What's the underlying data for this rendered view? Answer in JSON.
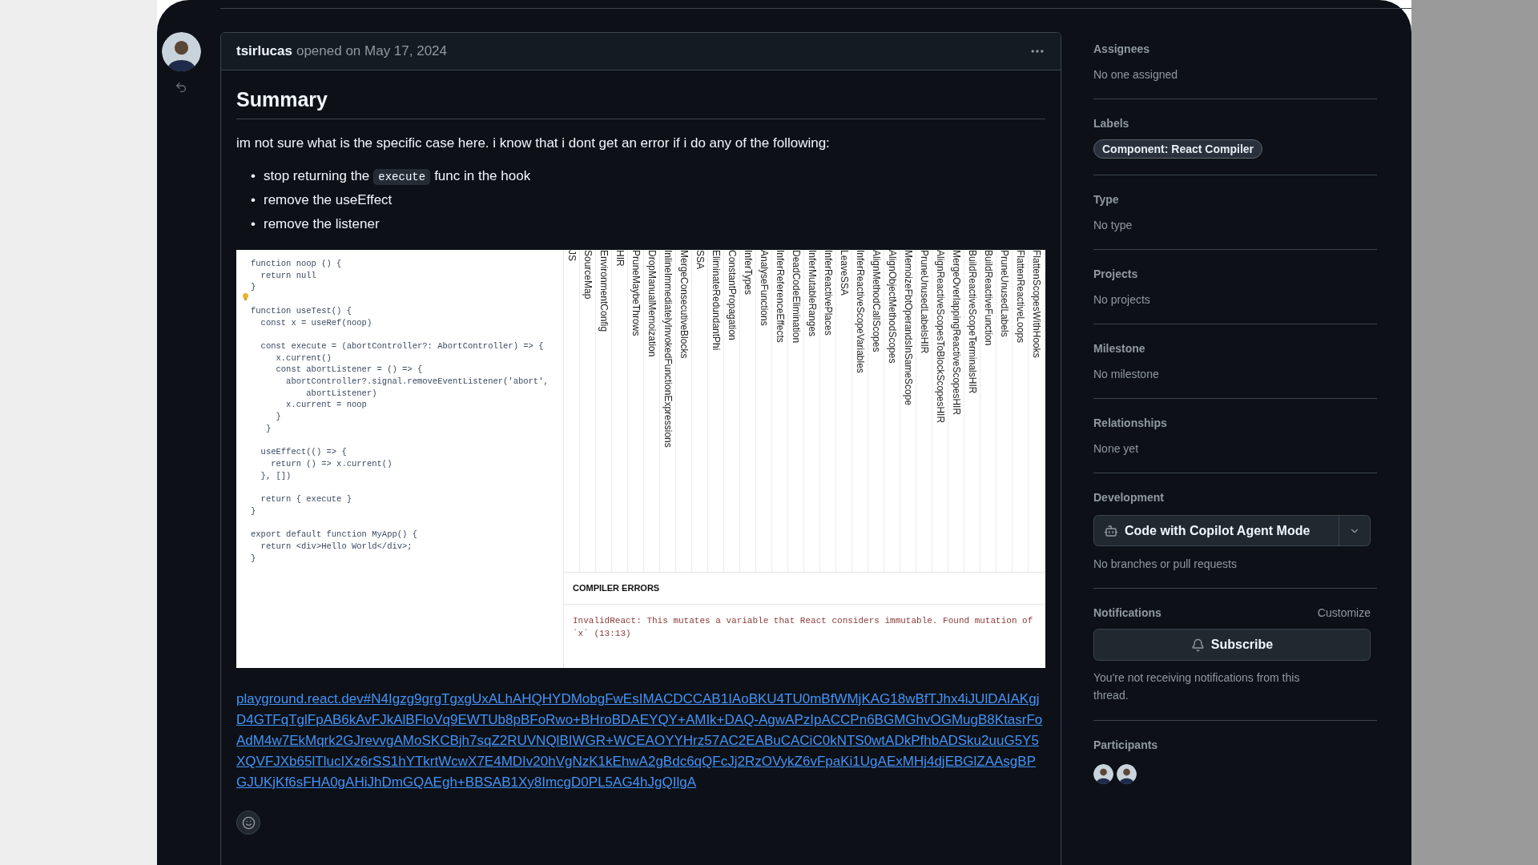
{
  "comment": {
    "author": "tsirlucas",
    "meta": "opened on May 17, 2024",
    "heading": "Summary",
    "paragraph": "im not sure what is the specific case here. i know that i dont get an error if i do any of the following:",
    "list": [
      {
        "marker": "•",
        "segments": [
          {
            "kind": "text",
            "text": "stop returning the"
          },
          {
            "kind": "code",
            "text": "execute"
          },
          {
            "kind": "text",
            "text": "func in the hook"
          }
        ]
      },
      {
        "marker": "•",
        "segments": [
          {
            "kind": "text",
            "text": "remove the useEffect"
          }
        ]
      },
      {
        "marker": "•",
        "segments": [
          {
            "kind": "text",
            "text": "remove the listener"
          }
        ]
      }
    ],
    "screenshot": {
      "code": "function noop () {\n  return null\n}\n\nfunction useTest() {\n  const x = useRef(noop)\n\n  const execute = (abortController?: AbortController) => {\n     x.current()\n     const abortListener = () => {\n       abortController?.signal.removeEventListener('abort',\n           abortListener)\n       x.current = noop\n     }\n   }\n\n  useEffect(() => {\n    return () => x.current()\n  }, [])\n\n  return { execute }\n}\n\nexport default function MyApp() {\n  return <div>Hello World</div>;\n}",
      "passes": [
        "JS",
        "SourceMap",
        "EnvironmentConfig",
        "HIR",
        "PruneMaybeThrows",
        "DropManualMemoization",
        "InlineImmediatelyInvokedFunctionExpressions",
        "MergeConsecutiveBlocks",
        "SSA",
        "EliminateRedundantPhi",
        "ConstantPropagation",
        "InferTypes",
        "AnalyseFunctions",
        "InferReferenceEffects",
        "DeadCodeElimination",
        "InferMutableRanges",
        "InferReactivePlaces",
        "LeaveSSA",
        "InferReactiveScopeVariables",
        "AlignMethodCallScopes",
        "AlignObjectMethodScopes",
        "MemoizeFbtOperandsInSameScope",
        "PruneUnusedLabelsHIR",
        "AlignReactiveScopesToBlockScopesHIR",
        "MergeOverlappingReactiveScopesHIR",
        "BuildReactiveScopeTerminalsHIR",
        "BuildReactiveFunction",
        "PruneUnusedLabels",
        "FlattenReactiveLoops",
        "FlattenScopesWithHooks"
      ],
      "errors_title": "COMPILER ERRORS",
      "error": "InvalidReact: This mutates a variable that React considers immutable. Found mutation of `x` (13:13)"
    },
    "link": "playground.react.dev#N4Igzg9grgTgxgUxALhAHQHYDMobgFwEsIMACDCCAB1IAoBKU4TU0mBfWMjKAG18wBfTJhx4iJUlDAIAKgjD4GTFqTglFpAB6kAvFJkAlBFloVq9EWTUb8pBFoRwo+BHroBDAEYQY+AMIk+DAQ-AgwAPzIpACCPn6BGMGhvOGMugB8KtasrFoAdM4w7EkMqrk2GJrevvgAMoSKCBjh7sqZ2RUVNQlBIWGR+WCEAOYYHrz57AC2EABuCACiC0kNTS0wtADkPfhbADSku2uuG5Y5XQVFJXb65lTlucIXz6rSS1hYTkrtWcwX7E4MDIv20hVgNzK1kEhwA2gBdc6qQFcJj2RzOVykZ6vFpaKi1UgAExMHj4djEBGlZAAsgBPGJUKjKf6sFHA0gAHiJhDmGQAEgh+BBSAB1Xy8ImcgD0PL5AG4hJgQIlgA"
  },
  "sidebar": [
    {
      "kind": "text",
      "title": "Assignees",
      "value": "No one assigned"
    },
    {
      "kind": "labels",
      "title": "Labels",
      "labels": [
        "Component: React Compiler"
      ]
    },
    {
      "kind": "text",
      "title": "Type",
      "value": "No type"
    },
    {
      "kind": "text",
      "title": "Projects",
      "value": "No projects"
    },
    {
      "kind": "text",
      "title": "Milestone",
      "value": "No milestone"
    },
    {
      "kind": "text",
      "title": "Relationships",
      "value": "None yet"
    },
    {
      "kind": "development",
      "title": "Development",
      "button": "Code with Copilot Agent Mode",
      "value": "No branches or pull requests"
    },
    {
      "kind": "notifications",
      "title": "Notifications",
      "action": "Customize",
      "button": "Subscribe",
      "value": "You're not receiving notifications from this thread."
    },
    {
      "kind": "participants",
      "title": "Participants",
      "avatars": [
        {
          "kind": "photo"
        },
        {
          "kind": "photo"
        }
      ]
    }
  ]
}
